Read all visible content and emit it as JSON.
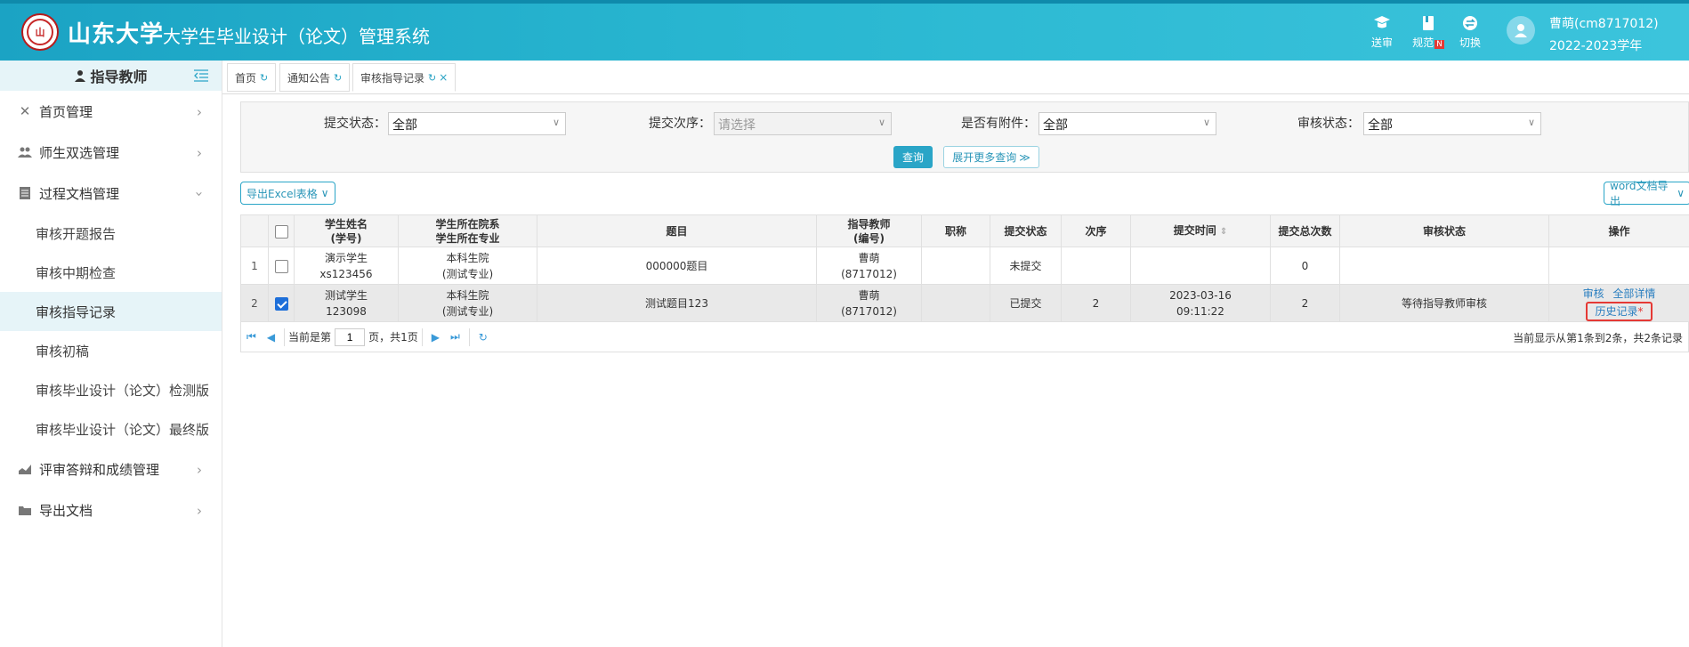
{
  "header": {
    "school": "山东大学",
    "system": "大学生毕业设计（论文）管理系统",
    "buttons": [
      {
        "label": "送审",
        "icon": "graduation-cap-icon"
      },
      {
        "label": "规范",
        "icon": "book-icon",
        "badge": "N"
      },
      {
        "label": "切换",
        "icon": "switch-icon"
      }
    ],
    "user_name": "曹萌(cm8717012)",
    "school_year": "2022-2023学年"
  },
  "sidebar": {
    "role": "指导教师",
    "items": [
      {
        "label": "首页管理",
        "icon": "tools-icon"
      },
      {
        "label": "师生双选管理",
        "icon": "users-icon"
      },
      {
        "label": "过程文档管理",
        "icon": "document-icon"
      }
    ],
    "subitems": [
      "审核开题报告",
      "审核中期检查",
      "审核指导记录",
      "审核初稿",
      "审核毕业设计（论文）检测版",
      "审核毕业设计（论文）最终版"
    ],
    "bottom_items": [
      {
        "label": "评审答辩和成绩管理",
        "icon": "chart-icon"
      },
      {
        "label": "导出文档",
        "icon": "folder-icon"
      }
    ]
  },
  "tabs": [
    "首页",
    "通知公告",
    "审核指导记录"
  ],
  "filter": {
    "submit_status_label": "提交状态：",
    "submit_status_value": "全部",
    "submit_order_label": "提交次序：",
    "submit_order_placeholder": "请选择",
    "attachment_label": "是否有附件：",
    "attachment_value": "全部",
    "review_status_label": "审核状态：",
    "review_status_value": "全部",
    "query_button": "查询",
    "more_button": "展开更多查询"
  },
  "toolbar": {
    "export_excel": "导出Excel表格",
    "export_word": "word文档导出"
  },
  "table": {
    "headers": {
      "student": "学生姓名",
      "student_sub": "(学号)",
      "dept": "学生所在院系",
      "dept_sub": "学生所在专业",
      "topic": "题目",
      "teacher": "指导教师",
      "teacher_sub": "(编号)",
      "title": "职称",
      "submit_status": "提交状态",
      "order": "次序",
      "submit_time": "提交时间",
      "submit_count": "提交总次数",
      "review_status": "审核状态",
      "ops": "操作"
    },
    "rows": [
      {
        "num": "1",
        "checked": false,
        "student": "演示学生",
        "student_id": "xs123456",
        "dept": "本科生院",
        "major": "(测试专业)",
        "topic": "000000题目",
        "teacher": "曹萌",
        "teacher_id": "(8717012)",
        "title": "",
        "submit_status": "未提交",
        "order": "",
        "date": "",
        "time": "",
        "count": "0",
        "review_status": ""
      },
      {
        "num": "2",
        "checked": true,
        "student": "测试学生",
        "student_id": "123098",
        "dept": "本科生院",
        "major": "(测试专业)",
        "topic": "测试题目123",
        "teacher": "曹萌",
        "teacher_id": "(8717012)",
        "title": "",
        "submit_status": "已提交",
        "order": "2",
        "date": "2023-03-16",
        "time": "09:11:22",
        "count": "2",
        "review_status": "等待指导教师审核",
        "op_review": "审核",
        "op_detail": "全部详情",
        "op_history": "历史记录"
      }
    ]
  },
  "pager": {
    "prefix": "当前是第",
    "page": "1",
    "suffix": "页，共1页",
    "summary": "当前显示从第1条到2条，共2条记录"
  },
  "colors": {
    "header": "#29b7d1",
    "accent": "#2aa5c7",
    "warning": "#f07c1c",
    "highlight": "#e53935"
  }
}
